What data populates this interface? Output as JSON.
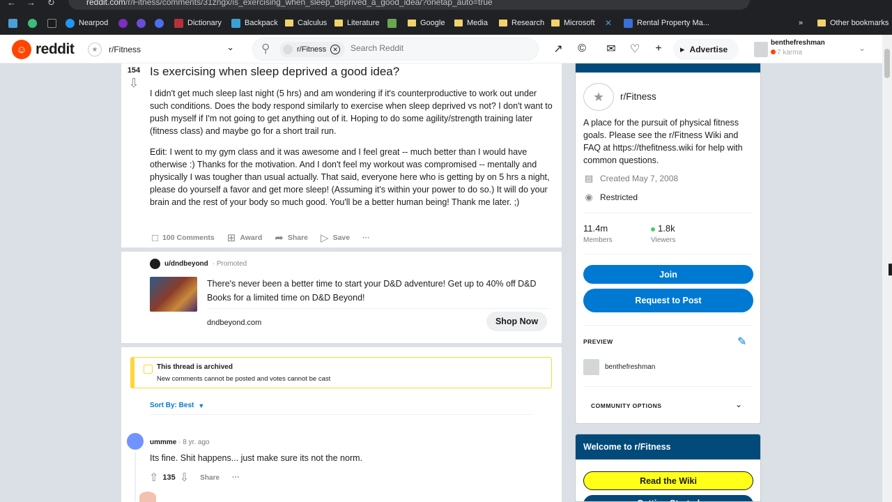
{
  "browser": {
    "url_domain": "reddit.com",
    "url_path": "/r/Fitness/comments/31zngx/is_exercising_when_sleep_deprived_a_good_idea/?onetap_auto=true",
    "bookmarks": [
      "Nearpod",
      "Dictionary",
      "Backpack",
      "Calculus",
      "Literature",
      "Google",
      "Media",
      "Research",
      "Microsoft",
      "Rental Property Ma..."
    ],
    "overflow": "»",
    "other_bookmarks": "Other bookmarks"
  },
  "header": {
    "logo_text": "reddit",
    "subreddit": "r/Fitness",
    "search_chip": "r/Fitness",
    "search_placeholder": "Search Reddit",
    "advertise": "Advertise",
    "username": "benthefreshman",
    "karma": "7 karma"
  },
  "post": {
    "votes": "154",
    "title": "Is exercising when sleep deprived a good idea?",
    "body": [
      "I didn't get much sleep last night (5 hrs) and am wondering if it's counterproductive to work out under such conditions. Does the body respond similarly to exercise when sleep deprived vs not? I don't want to push myself if I'm not going to get anything out of it. Hoping to do some agility/strength training later (fitness class) and maybe go for a short trail run.",
      "Edit: I went to my gym class and it was awesome and I feel great -- much better than I would have otherwise :) Thanks for the motivation. And I don't feel my workout was compromised -- mentally and physically I was tougher than usual actually. That said, everyone here who is getting by on 5 hrs a night, please do yourself a favor and get more sleep! (Assuming it's within your power to do so.) It will do your brain and the rest of your body so much good. You'll be a better human being! Thank me later. ;)"
    ],
    "actions": {
      "comments": "100 Comments",
      "award": "Award",
      "share": "Share",
      "save": "Save",
      "more": "···"
    }
  },
  "ad": {
    "user": "u/dndbeyond",
    "promoted": "· Promoted",
    "text": "There's never been a better time to start your D&D adventure! Get up to 40% off D&D Books for a limited time on D&D Beyond!",
    "domain": "dndbeyond.com",
    "cta": "Shop Now"
  },
  "archived": {
    "title": "This thread is archived",
    "subtitle": "New comments cannot be posted and votes cannot be cast"
  },
  "sort": {
    "label": "Sort By: Best"
  },
  "comment": {
    "user": "ummme",
    "age": "· 8 yr. ago",
    "body": "Its fine. Shit happens... just make sure its not the norm.",
    "votes": "135",
    "share": "Share",
    "more": "···"
  },
  "sidebar": {
    "name": "r/Fitness",
    "description": "A place for the pursuit of physical fitness goals. Please see the r/Fitness Wiki and FAQ at https://thefitness.wiki for help with common questions.",
    "created": "Created May 7, 2008",
    "restricted": "Restricted",
    "members_count": "11.4m",
    "members_label": "Members",
    "viewers_count": "1.8k",
    "viewers_label": "Viewers",
    "join": "Join",
    "request_post": "Request to Post",
    "preview_label": "PREVIEW",
    "preview_user": "benthefreshman",
    "community_options": "COMMUNITY OPTIONS",
    "welcome": "Welcome to r/Fitness",
    "read_wiki": "Read the Wiki",
    "getting_started": "Getting Started"
  },
  "colors": {
    "brand": "#ff4500",
    "primary_blue": "#0079d3",
    "banner_navy": "#024a7a",
    "archived_yellow": "#ffd635",
    "wiki_yellow": "#ffff1a",
    "online_green": "#46d160"
  }
}
